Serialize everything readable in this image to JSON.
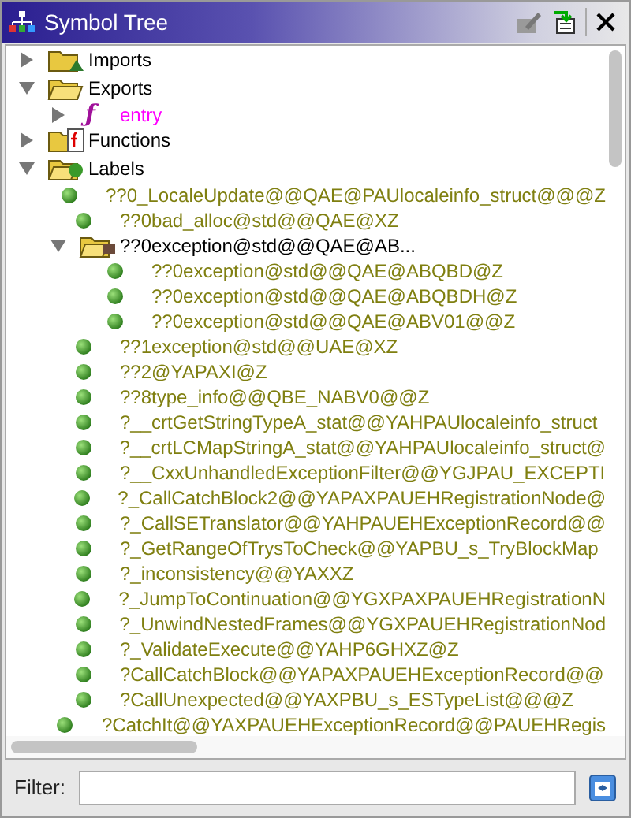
{
  "window": {
    "title": "Symbol Tree"
  },
  "tree": [
    {
      "kind": "imports",
      "label": "Imports",
      "expanded": false
    },
    {
      "kind": "exports",
      "label": "Exports",
      "expanded": true,
      "children": [
        {
          "kind": "function",
          "icon": "ƒ",
          "label": "entry",
          "expanded": false
        }
      ]
    },
    {
      "kind": "functions",
      "label": "Functions",
      "expanded": false
    },
    {
      "kind": "labels",
      "label": "Labels",
      "expanded": true,
      "children": [
        {
          "kind": "label",
          "label": "??0_LocaleUpdate@@QAE@PAUlocaleinfo_struct@@@Z"
        },
        {
          "kind": "label",
          "label": "??0bad_alloc@std@@QAE@XZ"
        },
        {
          "kind": "namespace",
          "label": "??0exception@std@@QAE@AB...",
          "expanded": true,
          "children": [
            {
              "kind": "label",
              "label": "??0exception@std@@QAE@ABQBD@Z"
            },
            {
              "kind": "label",
              "label": "??0exception@std@@QAE@ABQBDH@Z"
            },
            {
              "kind": "label",
              "label": "??0exception@std@@QAE@ABV01@@Z"
            }
          ]
        },
        {
          "kind": "label",
          "label": "??1exception@std@@UAE@XZ"
        },
        {
          "kind": "label",
          "label": "??2@YAPAXI@Z"
        },
        {
          "kind": "label",
          "label": "??8type_info@@QBE_NABV0@@Z"
        },
        {
          "kind": "label",
          "label": "?__crtGetStringTypeA_stat@@YAHPAUlocaleinfo_struct"
        },
        {
          "kind": "label",
          "label": "?__crtLCMapStringA_stat@@YAHPAUlocaleinfo_struct@"
        },
        {
          "kind": "label",
          "label": "?__CxxUnhandledExceptionFilter@@YGJPAU_EXCEPTI"
        },
        {
          "kind": "label",
          "label": "?_CallCatchBlock2@@YAPAXPAUEHRegistrationNode@"
        },
        {
          "kind": "label",
          "label": "?_CallSETranslator@@YAHPAUEHExceptionRecord@@"
        },
        {
          "kind": "label",
          "label": "?_GetRangeOfTrysToCheck@@YAPBU_s_TryBlockMap"
        },
        {
          "kind": "label",
          "label": "?_inconsistency@@YAXXZ"
        },
        {
          "kind": "label",
          "label": "?_JumpToContinuation@@YGXPAXPAUEHRegistrationN"
        },
        {
          "kind": "label",
          "label": "?_UnwindNestedFrames@@YGXPAUEHRegistrationNod"
        },
        {
          "kind": "label",
          "label": "?_ValidateExecute@@YAHP6GHXZ@Z"
        },
        {
          "kind": "label",
          "label": "?CallCatchBlock@@YAPAXPAUEHExceptionRecord@@"
        },
        {
          "kind": "label",
          "label": "?CallUnexpected@@YAXPBU_s_ESTypeList@@@Z"
        },
        {
          "kind": "label",
          "label": "?CatchIt@@YAXPAUEHExceptionRecord@@PAUEHRegis"
        }
      ]
    }
  ],
  "filter": {
    "label": "Filter:"
  }
}
